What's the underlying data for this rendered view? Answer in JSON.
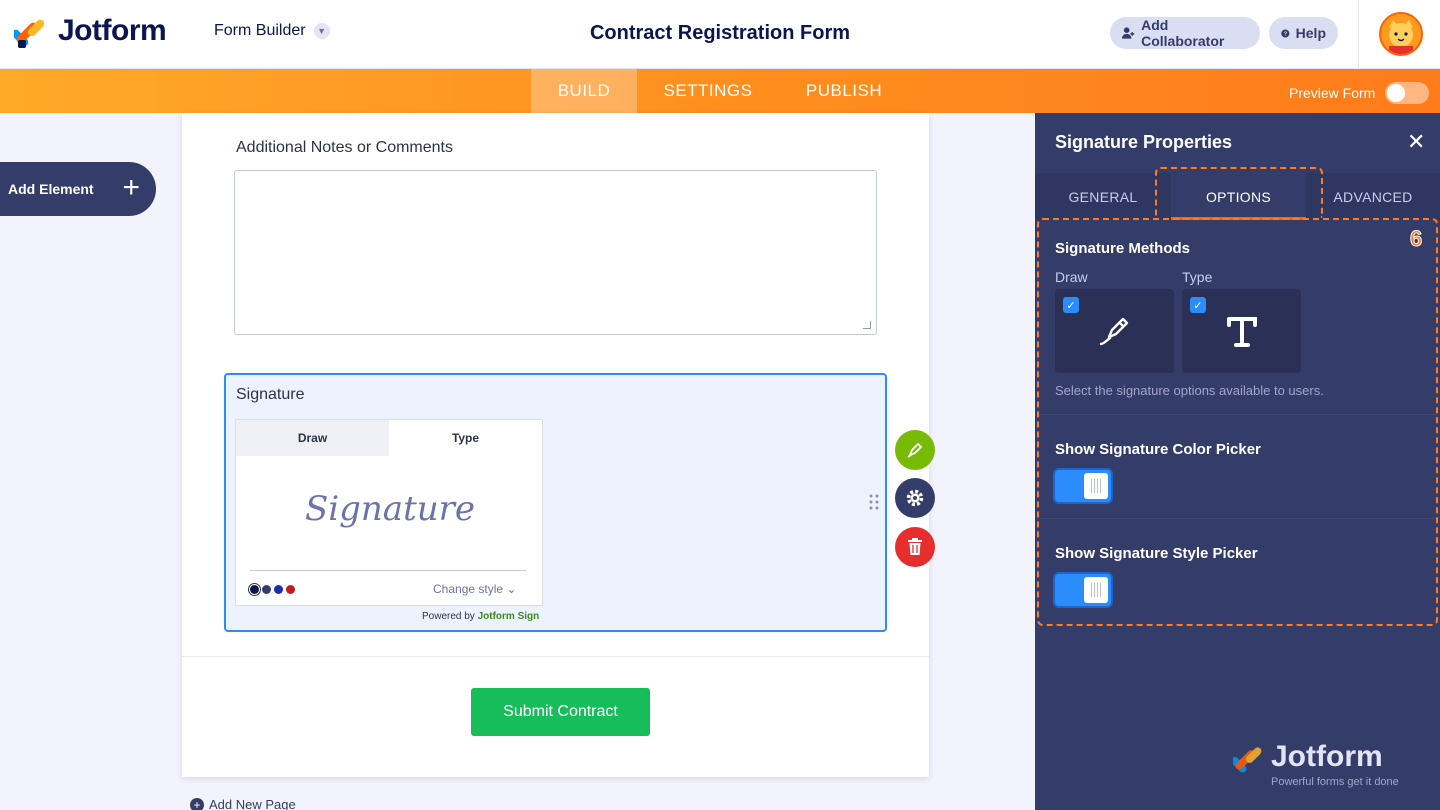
{
  "header": {
    "brand": "Jotform",
    "builder_menu": "Form Builder",
    "form_title": "Contract Registration Form",
    "add_collaborator": "Add Collaborator",
    "help": "Help"
  },
  "nav": {
    "tabs": [
      "BUILD",
      "SETTINGS",
      "PUBLISH"
    ],
    "active": "BUILD",
    "preview_label": "Preview Form",
    "preview_on": false
  },
  "sidebar": {
    "add_element": "Add Element"
  },
  "form": {
    "notes_label": "Additional Notes or Comments",
    "signature_label": "Signature",
    "sig_tabs": [
      "Draw",
      "Type"
    ],
    "sig_placeholder": "Signature",
    "change_style": "Change style",
    "powered_by": "Powered by",
    "powered_brand": "Jotform Sign",
    "colors": [
      "#0a1551",
      "#343c6a",
      "#1d2fa8",
      "#c21b1b"
    ],
    "submit_label": "Submit Contract",
    "add_page": "Add New Page"
  },
  "panel": {
    "title": "Signature Properties",
    "tabs": [
      "GENERAL",
      "OPTIONS",
      "ADVANCED"
    ],
    "active_tab": "OPTIONS",
    "step_number": "6",
    "methods_title": "Signature Methods",
    "method_draw": "Draw",
    "method_type": "Type",
    "methods_hint": "Select the signature options available to users.",
    "color_picker_title": "Show Signature Color Picker",
    "color_picker_on": true,
    "style_picker_title": "Show Signature Style Picker",
    "style_picker_on": true
  },
  "footer_brand": {
    "name": "Jotform",
    "tagline": "Powerful forms get it done"
  },
  "colors": {
    "accent_orange": "#ff7b1c",
    "panel_bg": "#343c6a",
    "toggle_blue": "#2b8dfb",
    "submit_green": "#18bd5b"
  }
}
